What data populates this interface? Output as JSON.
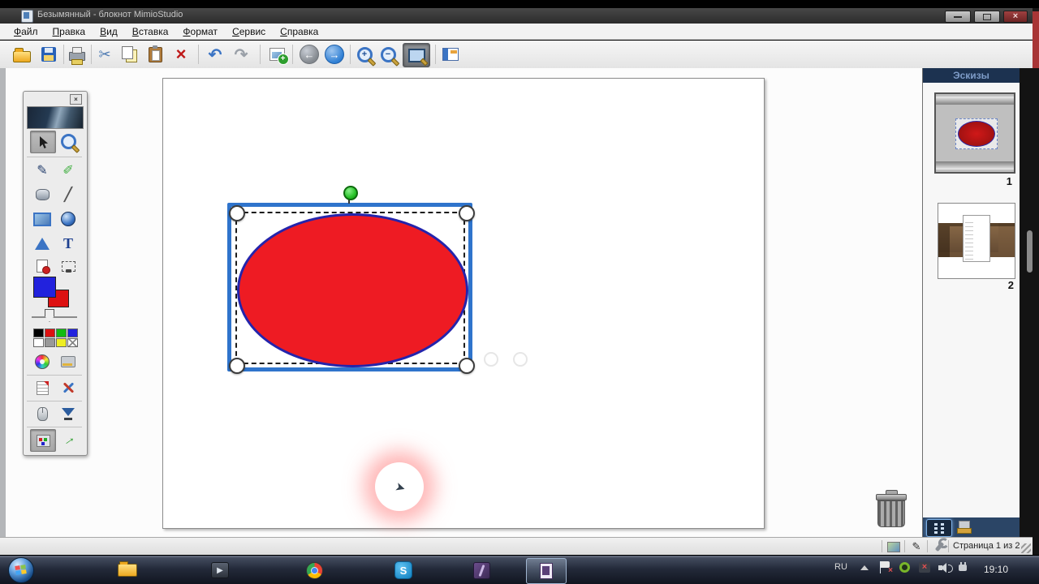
{
  "window": {
    "title": "Безымянный - блокнот MimioStudio",
    "close_glyph": "×"
  },
  "menu": {
    "items": [
      "Файл",
      "Правка",
      "Вид",
      "Вставка",
      "Формат",
      "Сервис",
      "Справка"
    ]
  },
  "toolbar": {
    "glyphs": {
      "cut": "✂",
      "delete": "×",
      "undo": "↶",
      "redo": "↷",
      "back": "←",
      "forward": "→",
      "zoom_in": "+",
      "zoom_out": "−"
    }
  },
  "palette": {
    "close_glyph": "×",
    "pen_glyph": "✎",
    "highlighter_glyph": "✐",
    "line_glyph": "╱",
    "text_tool_glyph": "T",
    "green_arrow_glyph": "→",
    "foreground_color": "#2222dd",
    "background_color": "#dd1111",
    "swatches": [
      "#000000",
      "#dd1111",
      "#11bb11",
      "#2222dd",
      "#ffffff",
      "#999999",
      "#eeee22",
      "transparent"
    ]
  },
  "canvas": {
    "shape_fill": "#ee1b23",
    "shape_stroke": "#2424ac",
    "selection_color": "#2f74cc",
    "rotation_handle_color": "#28c228"
  },
  "thumbnails": {
    "title": "Эскизы",
    "pages": [
      {
        "number": "1"
      },
      {
        "number": "2"
      }
    ]
  },
  "statusbar": {
    "pen_glyph": "✎",
    "page_indicator": "Страница 1 из 2"
  },
  "taskbar": {
    "language": "RU",
    "skype_glyph": "S",
    "player_glyph": "▶",
    "flag_x": "×",
    "red_x": "×",
    "clock": "19:10"
  }
}
